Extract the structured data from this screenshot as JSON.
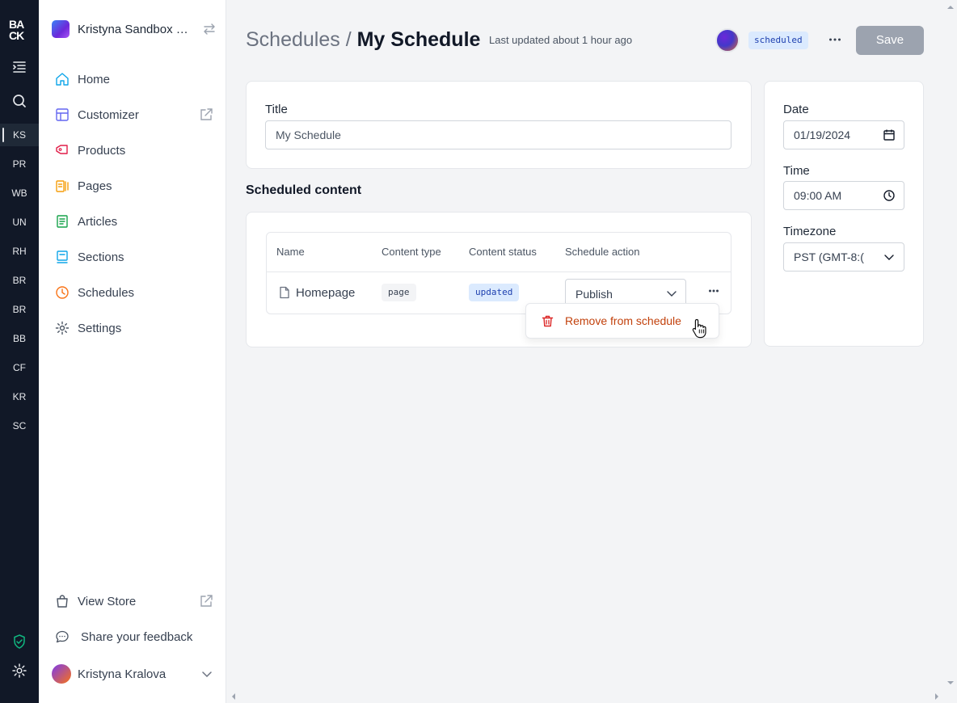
{
  "rail": {
    "logo": "BACK",
    "workspaces": [
      "KS",
      "PR",
      "WB",
      "UN",
      "RH",
      "BR",
      "BR",
      "BB",
      "CF",
      "KR",
      "SC"
    ],
    "active_workspace": "KS"
  },
  "sidebar": {
    "store_name": "Kristyna Sandbox S...",
    "nav": [
      {
        "label": "Home",
        "icon": "home-icon"
      },
      {
        "label": "Customizer",
        "icon": "layout-icon"
      },
      {
        "label": "Products",
        "icon": "tag-icon"
      },
      {
        "label": "Pages",
        "icon": "pages-icon"
      },
      {
        "label": "Articles",
        "icon": "articles-icon"
      },
      {
        "label": "Sections",
        "icon": "sections-icon"
      },
      {
        "label": "Schedules",
        "icon": "clock-icon"
      },
      {
        "label": "Settings",
        "icon": "gear-icon"
      }
    ],
    "view_store": "View Store",
    "feedback": "Share your feedback",
    "user_name": "Kristyna Kralova"
  },
  "header": {
    "breadcrumb": "Schedules /",
    "title": "My Schedule",
    "last_updated": "Last updated about 1 hour ago",
    "status": "scheduled",
    "save_label": "Save"
  },
  "form": {
    "title_label": "Title",
    "title_value": "My Schedule",
    "date_label": "Date",
    "date_value": "01/19/2024",
    "time_label": "Time",
    "time_value": "09:00 AM",
    "timezone_label": "Timezone",
    "timezone_value": "PST (GMT-8:("
  },
  "scheduled": {
    "section_title": "Scheduled content",
    "columns": [
      "Name",
      "Content type",
      "Content status",
      "Schedule action"
    ],
    "rows": [
      {
        "name": "Homepage",
        "type": "page",
        "status": "updated",
        "action": "Publish"
      }
    ]
  },
  "menu": {
    "remove_label": "Remove from schedule"
  },
  "colors": {
    "rail_bg": "#111827",
    "status_blue": "#dbeafe",
    "danger": "#dc2626"
  }
}
